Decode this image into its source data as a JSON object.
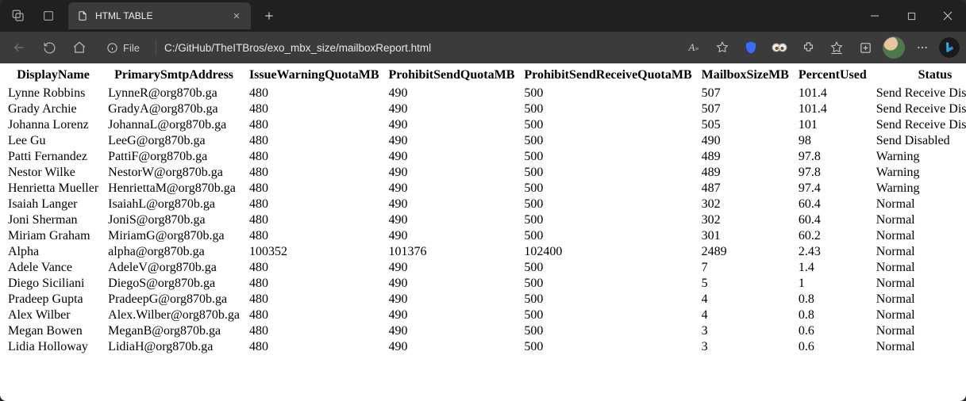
{
  "tab": {
    "title": "HTML TABLE"
  },
  "url": {
    "scheme_label": "File",
    "path": "C:/GitHub/TheITBros/exo_mbx_size/mailboxReport.html"
  },
  "table": {
    "headers": [
      "DisplayName",
      "PrimarySmtpAddress",
      "IssueWarningQuotaMB",
      "ProhibitSendQuotaMB",
      "ProhibitSendReceiveQuotaMB",
      "MailboxSizeMB",
      "PercentUsed",
      "Status"
    ],
    "rows": [
      {
        "DisplayName": "Lynne Robbins",
        "PrimarySmtpAddress": "LynneR@org870b.ga",
        "IssueWarningQuotaMB": "480",
        "ProhibitSendQuotaMB": "490",
        "ProhibitSendReceiveQuotaMB": "500",
        "MailboxSizeMB": "507",
        "PercentUsed": "101.4",
        "Status": "Send Receive Disabled"
      },
      {
        "DisplayName": "Grady Archie",
        "PrimarySmtpAddress": "GradyA@org870b.ga",
        "IssueWarningQuotaMB": "480",
        "ProhibitSendQuotaMB": "490",
        "ProhibitSendReceiveQuotaMB": "500",
        "MailboxSizeMB": "507",
        "PercentUsed": "101.4",
        "Status": "Send Receive Disabled"
      },
      {
        "DisplayName": "Johanna Lorenz",
        "PrimarySmtpAddress": "JohannaL@org870b.ga",
        "IssueWarningQuotaMB": "480",
        "ProhibitSendQuotaMB": "490",
        "ProhibitSendReceiveQuotaMB": "500",
        "MailboxSizeMB": "505",
        "PercentUsed": "101",
        "Status": "Send Receive Disabled"
      },
      {
        "DisplayName": "Lee Gu",
        "PrimarySmtpAddress": "LeeG@org870b.ga",
        "IssueWarningQuotaMB": "480",
        "ProhibitSendQuotaMB": "490",
        "ProhibitSendReceiveQuotaMB": "500",
        "MailboxSizeMB": "490",
        "PercentUsed": "98",
        "Status": "Send Disabled"
      },
      {
        "DisplayName": "Patti Fernandez",
        "PrimarySmtpAddress": "PattiF@org870b.ga",
        "IssueWarningQuotaMB": "480",
        "ProhibitSendQuotaMB": "490",
        "ProhibitSendReceiveQuotaMB": "500",
        "MailboxSizeMB": "489",
        "PercentUsed": "97.8",
        "Status": "Warning"
      },
      {
        "DisplayName": "Nestor Wilke",
        "PrimarySmtpAddress": "NestorW@org870b.ga",
        "IssueWarningQuotaMB": "480",
        "ProhibitSendQuotaMB": "490",
        "ProhibitSendReceiveQuotaMB": "500",
        "MailboxSizeMB": "489",
        "PercentUsed": "97.8",
        "Status": "Warning"
      },
      {
        "DisplayName": "Henrietta Mueller",
        "PrimarySmtpAddress": "HenriettaM@org870b.ga",
        "IssueWarningQuotaMB": "480",
        "ProhibitSendQuotaMB": "490",
        "ProhibitSendReceiveQuotaMB": "500",
        "MailboxSizeMB": "487",
        "PercentUsed": "97.4",
        "Status": "Warning"
      },
      {
        "DisplayName": "Isaiah Langer",
        "PrimarySmtpAddress": "IsaiahL@org870b.ga",
        "IssueWarningQuotaMB": "480",
        "ProhibitSendQuotaMB": "490",
        "ProhibitSendReceiveQuotaMB": "500",
        "MailboxSizeMB": "302",
        "PercentUsed": "60.4",
        "Status": "Normal"
      },
      {
        "DisplayName": "Joni Sherman",
        "PrimarySmtpAddress": "JoniS@org870b.ga",
        "IssueWarningQuotaMB": "480",
        "ProhibitSendQuotaMB": "490",
        "ProhibitSendReceiveQuotaMB": "500",
        "MailboxSizeMB": "302",
        "PercentUsed": "60.4",
        "Status": "Normal"
      },
      {
        "DisplayName": "Miriam Graham",
        "PrimarySmtpAddress": "MiriamG@org870b.ga",
        "IssueWarningQuotaMB": "480",
        "ProhibitSendQuotaMB": "490",
        "ProhibitSendReceiveQuotaMB": "500",
        "MailboxSizeMB": "301",
        "PercentUsed": "60.2",
        "Status": "Normal"
      },
      {
        "DisplayName": "Alpha",
        "PrimarySmtpAddress": "alpha@org870b.ga",
        "IssueWarningQuotaMB": "100352",
        "ProhibitSendQuotaMB": "101376",
        "ProhibitSendReceiveQuotaMB": "102400",
        "MailboxSizeMB": "2489",
        "PercentUsed": "2.43",
        "Status": "Normal"
      },
      {
        "DisplayName": "Adele Vance",
        "PrimarySmtpAddress": "AdeleV@org870b.ga",
        "IssueWarningQuotaMB": "480",
        "ProhibitSendQuotaMB": "490",
        "ProhibitSendReceiveQuotaMB": "500",
        "MailboxSizeMB": "7",
        "PercentUsed": "1.4",
        "Status": "Normal"
      },
      {
        "DisplayName": "Diego Siciliani",
        "PrimarySmtpAddress": "DiegoS@org870b.ga",
        "IssueWarningQuotaMB": "480",
        "ProhibitSendQuotaMB": "490",
        "ProhibitSendReceiveQuotaMB": "500",
        "MailboxSizeMB": "5",
        "PercentUsed": "1",
        "Status": "Normal"
      },
      {
        "DisplayName": "Pradeep Gupta",
        "PrimarySmtpAddress": "PradeepG@org870b.ga",
        "IssueWarningQuotaMB": "480",
        "ProhibitSendQuotaMB": "490",
        "ProhibitSendReceiveQuotaMB": "500",
        "MailboxSizeMB": "4",
        "PercentUsed": "0.8",
        "Status": "Normal"
      },
      {
        "DisplayName": "Alex Wilber",
        "PrimarySmtpAddress": "Alex.Wilber@org870b.ga",
        "IssueWarningQuotaMB": "480",
        "ProhibitSendQuotaMB": "490",
        "ProhibitSendReceiveQuotaMB": "500",
        "MailboxSizeMB": "4",
        "PercentUsed": "0.8",
        "Status": "Normal"
      },
      {
        "DisplayName": "Megan Bowen",
        "PrimarySmtpAddress": "MeganB@org870b.ga",
        "IssueWarningQuotaMB": "480",
        "ProhibitSendQuotaMB": "490",
        "ProhibitSendReceiveQuotaMB": "500",
        "MailboxSizeMB": "3",
        "PercentUsed": "0.6",
        "Status": "Normal"
      },
      {
        "DisplayName": "Lidia Holloway",
        "PrimarySmtpAddress": "LidiaH@org870b.ga",
        "IssueWarningQuotaMB": "480",
        "ProhibitSendQuotaMB": "490",
        "ProhibitSendReceiveQuotaMB": "500",
        "MailboxSizeMB": "3",
        "PercentUsed": "0.6",
        "Status": "Normal"
      }
    ]
  }
}
